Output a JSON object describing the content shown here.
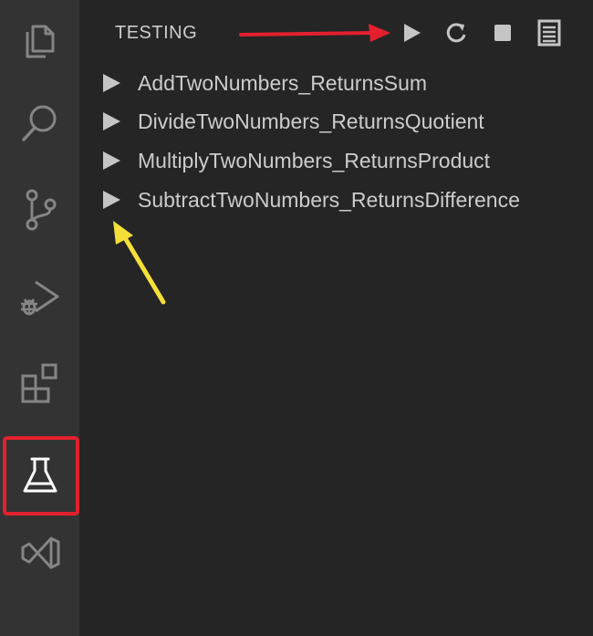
{
  "sidebar": {
    "title": "TESTING",
    "toolbar": {
      "run_all_icon": "play-icon",
      "refresh_icon": "refresh-icon",
      "stop_icon": "stop-icon",
      "output_icon": "output-log-icon"
    },
    "tests": [
      {
        "label": "AddTwoNumbers_ReturnsSum"
      },
      {
        "label": "DivideTwoNumbers_ReturnsQuotient"
      },
      {
        "label": "MultiplyTwoNumbers_ReturnsProduct"
      },
      {
        "label": "SubtractTwoNumbers_ReturnsDifference"
      }
    ]
  },
  "activity_bar": {
    "items": [
      {
        "icon": "explorer-icon"
      },
      {
        "icon": "search-icon"
      },
      {
        "icon": "source-control-icon"
      },
      {
        "icon": "run-debug-icon"
      },
      {
        "icon": "extensions-icon"
      },
      {
        "icon": "testing-flask-icon",
        "active": true
      },
      {
        "icon": "visual-studio-icon"
      }
    ]
  },
  "colors": {
    "activity_bar_bg": "#333333",
    "sidebar_bg": "#252526",
    "text": "#cccccc",
    "icon_inactive": "#858585",
    "highlight_red": "#e3202e",
    "annotation_yellow": "#f5e03a"
  }
}
